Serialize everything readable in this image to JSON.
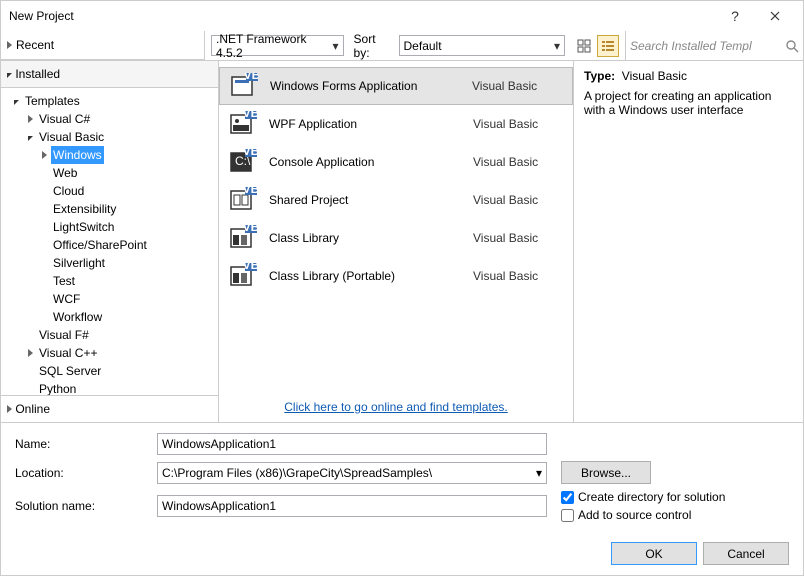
{
  "window": {
    "title": "New Project"
  },
  "treeHeaders": {
    "recent": "Recent",
    "installed": "Installed",
    "online": "Online"
  },
  "toolbar": {
    "framework": ".NET Framework 4.5.2",
    "sortby_label": "Sort by:",
    "sortby_value": "Default",
    "search_placeholder": "Search Installed Templ"
  },
  "tree": {
    "templates": "Templates",
    "vcsharp": "Visual C#",
    "vb": "Visual Basic",
    "vb_children": [
      "Windows",
      "Web",
      "Cloud",
      "Extensibility",
      "LightSwitch",
      "Office/SharePoint",
      "Silverlight",
      "Test",
      "WCF",
      "Workflow"
    ],
    "vfsharp": "Visual F#",
    "vcpp": "Visual C++",
    "sql": "SQL Server",
    "python": "Python"
  },
  "templates": [
    {
      "name": "Windows Forms Application",
      "lang": "Visual Basic",
      "icon": "winforms"
    },
    {
      "name": "WPF Application",
      "lang": "Visual Basic",
      "icon": "wpf"
    },
    {
      "name": "Console Application",
      "lang": "Visual Basic",
      "icon": "console"
    },
    {
      "name": "Shared Project",
      "lang": "Visual Basic",
      "icon": "shared"
    },
    {
      "name": "Class Library",
      "lang": "Visual Basic",
      "icon": "classlib"
    },
    {
      "name": "Class Library (Portable)",
      "lang": "Visual Basic",
      "icon": "classlibp"
    }
  ],
  "online_link": "Click here to go online and find templates.",
  "detail": {
    "type_label": "Type:",
    "type_value": "Visual Basic",
    "description": "A project for creating an application with a Windows user interface"
  },
  "form": {
    "name_label": "Name:",
    "name_value": "WindowsApplication1",
    "location_label": "Location:",
    "location_value": "C:\\Program Files (x86)\\GrapeCity\\SpreadSamples\\",
    "solution_label": "Solution name:",
    "solution_value": "WindowsApplication1",
    "browse": "Browse...",
    "create_dir": "Create directory for solution",
    "add_source": "Add to source control"
  },
  "buttons": {
    "ok": "OK",
    "cancel": "Cancel"
  }
}
